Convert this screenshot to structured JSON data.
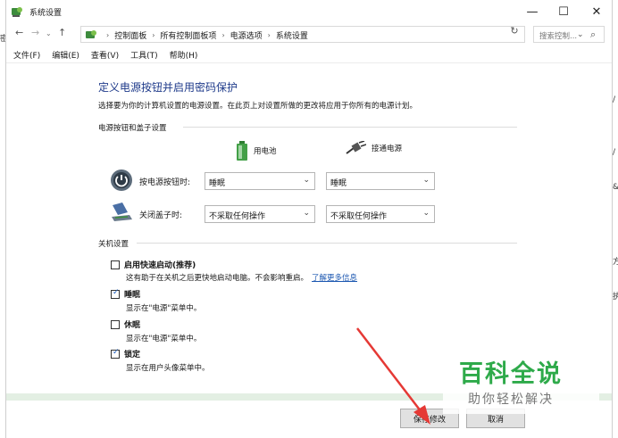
{
  "window": {
    "title": "系统设置",
    "minimize": "—",
    "maximize": "☐",
    "close": "✕"
  },
  "nav": {
    "back": "←",
    "forward": "→",
    "recent": "⌄",
    "up": "↑",
    "breadcrumbs": [
      "控制面板",
      "所有控制面板项",
      "电源选项",
      "系统设置"
    ],
    "separator": "›",
    "dropdown": "⌄",
    "refresh": "↻",
    "search_placeholder": "搜索控制...",
    "search_icon": "⌕"
  },
  "menu": [
    "文件(F)",
    "编辑(E)",
    "查看(V)",
    "工具(T)",
    "帮助(H)"
  ],
  "content": {
    "title": "定义电源按钮并启用密码保护",
    "description": "选择要为你的计算机设置的电源设置。在此页上对设置所做的更改将应用于你所有的电源计划。",
    "section_buttons": "电源按钮和盖子设置",
    "col_battery": "用电池",
    "col_plugged": "接通电源",
    "power_button_label": "按电源按钮时:",
    "power_button_battery": "睡眠",
    "power_button_plugged": "睡眠",
    "lid_label": "关闭盖子时:",
    "lid_battery": "不采取任何操作",
    "lid_plugged": "不采取任何操作",
    "select_arrow": "⌄",
    "section_shutdown": "关机设置",
    "options": [
      {
        "label": "启用快速启动(推荐)",
        "checked": false,
        "desc": "这有助于在关机之后更快地启动电脑。不会影响重启。",
        "link": "了解更多信息"
      },
      {
        "label": "睡眠",
        "checked": true,
        "desc": "显示在\"电源\"菜单中。",
        "link": ""
      },
      {
        "label": "休眠",
        "checked": false,
        "desc": "显示在\"电源\"菜单中。",
        "link": ""
      },
      {
        "label": "锁定",
        "checked": true,
        "desc": "显示在用户头像菜单中。",
        "link": ""
      }
    ],
    "check_mark": "✓"
  },
  "footer": {
    "save": "保存修改",
    "cancel": "取消"
  },
  "watermark": {
    "main": "百科全说",
    "sub": "助你轻松解决"
  },
  "edge_glyphs": {
    "left": "密",
    "right": [
      "/",
      "/",
      "&",
      "方",
      "执"
    ]
  },
  "colors": {
    "title_blue": "#1e3a8a",
    "link_blue": "#1a56b0",
    "arrow_red": "#e53935",
    "watermark_green": "#2eaa4a"
  }
}
